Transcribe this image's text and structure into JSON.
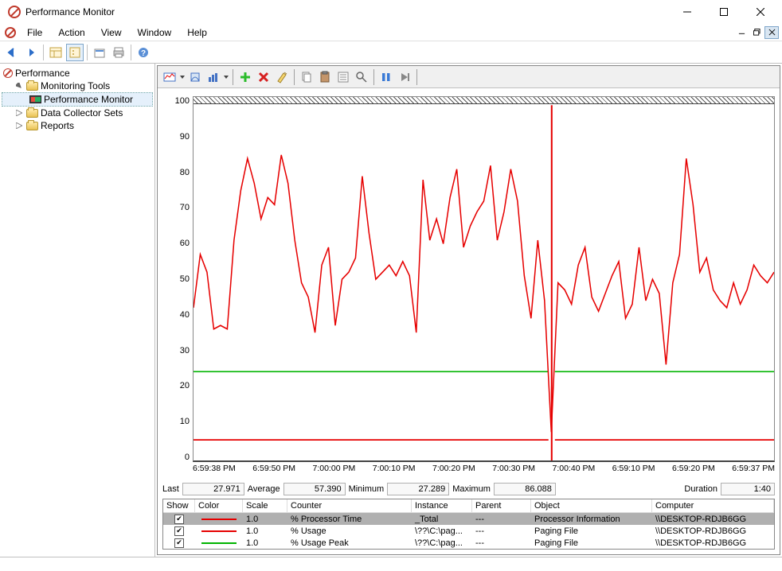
{
  "window": {
    "title": "Performance Monitor"
  },
  "menus": {
    "file": "File",
    "action": "Action",
    "view": "View",
    "window": "Window",
    "help": "Help"
  },
  "tree": {
    "root": "Performance",
    "monitoring_tools": "Monitoring Tools",
    "perf_monitor": "Performance Monitor",
    "data_collector": "Data Collector Sets",
    "reports": "Reports"
  },
  "chart_data": {
    "type": "line",
    "ylim": [
      0,
      100
    ],
    "yticks": [
      100,
      90,
      80,
      70,
      60,
      50,
      40,
      30,
      20,
      10,
      0
    ],
    "xlabels": [
      "6:59:38 PM",
      "6:59:50 PM",
      "7:00:00 PM",
      "7:00:10 PM",
      "7:00:20 PM",
      "7:00:30 PM",
      "7:00:40 PM",
      "6:59:10 PM",
      "6:59:20 PM",
      "6:59:37 PM"
    ],
    "cursor_pos": 0.617,
    "series": [
      {
        "name": "% Processor Time",
        "color": "#e60000",
        "values": [
          43,
          58,
          53,
          37,
          38,
          37,
          62,
          76,
          85,
          78,
          68,
          74,
          72,
          86,
          78,
          62,
          50,
          46,
          36,
          55,
          60,
          38,
          51,
          53,
          57,
          80,
          64,
          51,
          53,
          55,
          52,
          56,
          52,
          36,
          79,
          62,
          68,
          61,
          74,
          82,
          60,
          66,
          70,
          73,
          83,
          62,
          70,
          82,
          73,
          52,
          40,
          62,
          45,
          8,
          50,
          48,
          44,
          55,
          60,
          46,
          42,
          47,
          52,
          56,
          40,
          44,
          60,
          45,
          51,
          47,
          27,
          50,
          58,
          85,
          72,
          53,
          57,
          48,
          45,
          43,
          50,
          44,
          48,
          55,
          52,
          50,
          53
        ]
      },
      {
        "name": "% Usage",
        "color": "#e60000",
        "values": [
          5.8,
          5.8
        ]
      },
      {
        "name": "% Usage Peak",
        "color": "#00b400",
        "values": [
          25,
          25
        ]
      }
    ]
  },
  "stats": {
    "last_label": "Last",
    "last": "27.971",
    "avg_label": "Average",
    "avg": "57.390",
    "min_label": "Minimum",
    "min": "27.289",
    "max_label": "Maximum",
    "max": "86.088",
    "dur_label": "Duration",
    "dur": "1:40"
  },
  "counter_headers": {
    "show": "Show",
    "color": "Color",
    "scale": "Scale",
    "counter": "Counter",
    "instance": "Instance",
    "parent": "Parent",
    "object": "Object",
    "computer": "Computer"
  },
  "counters": [
    {
      "checked": true,
      "color": "#e60000",
      "scale": "1.0",
      "counter": "% Processor Time",
      "instance": "_Total",
      "parent": "---",
      "object": "Processor Information",
      "computer": "\\\\DESKTOP-RDJB6GG",
      "selected": true
    },
    {
      "checked": true,
      "color": "#e60000",
      "scale": "1.0",
      "counter": "% Usage",
      "instance": "\\??\\C:\\pag...",
      "parent": "---",
      "object": "Paging File",
      "computer": "\\\\DESKTOP-RDJB6GG",
      "selected": false
    },
    {
      "checked": true,
      "color": "#00b400",
      "scale": "1.0",
      "counter": "% Usage Peak",
      "instance": "\\??\\C:\\pag...",
      "parent": "---",
      "object": "Paging File",
      "computer": "\\\\DESKTOP-RDJB6GG",
      "selected": false
    }
  ]
}
